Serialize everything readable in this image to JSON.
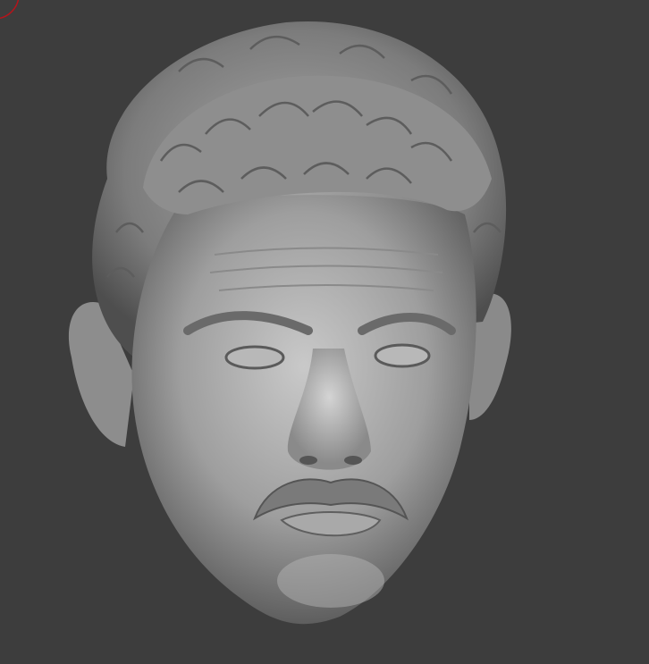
{
  "viewport": {
    "background_color": "#3d3d3d",
    "brush_cursor_color": "#b5141b",
    "model_base_color": "#9a9a9a",
    "model_highlight_color": "#cfcfcf",
    "model_shadow_color": "#5a5a5a"
  }
}
